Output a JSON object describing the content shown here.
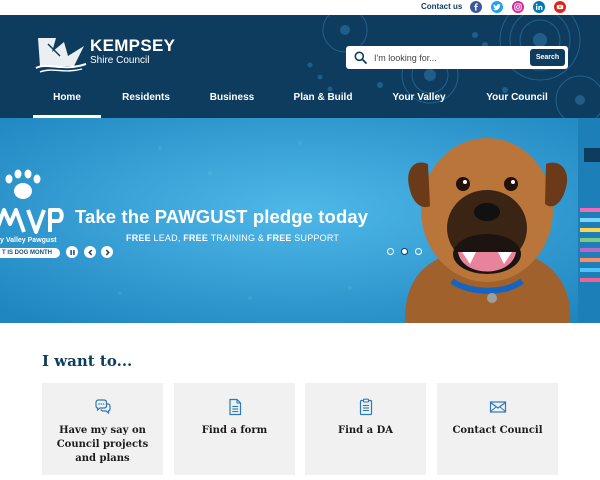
{
  "colors": {
    "brand_navy": "#0e3c5f",
    "banner_blue": "#2a9ad2",
    "card_grey": "#f1f1f1",
    "facebook": "#3b5998",
    "twitter": "#1da1f2",
    "instagram": "#d6249f",
    "linkedin": "#0077b5",
    "youtube": "#e62117"
  },
  "topbar": {
    "contact_label": "Contact us",
    "social": [
      {
        "name": "facebook",
        "icon": "facebook-icon"
      },
      {
        "name": "twitter",
        "icon": "twitter-icon"
      },
      {
        "name": "instagram",
        "icon": "instagram-icon"
      },
      {
        "name": "linkedin",
        "icon": "linkedin-icon"
      },
      {
        "name": "youtube",
        "icon": "youtube-icon"
      }
    ]
  },
  "header": {
    "logo_title": "KEMPSEY",
    "logo_subtitle": "Shire Council",
    "search": {
      "placeholder": "I'm looking for...",
      "button_label": "Search"
    },
    "nav": {
      "active": "Home",
      "items": [
        "Home",
        "Residents",
        "Business",
        "Plan & Build",
        "Your Valley",
        "Your Council"
      ]
    }
  },
  "hero": {
    "brand_fragment": "MVP",
    "brand_tagline": "y Valley Pawgust",
    "brand_pill": "T IS DOG MONTH",
    "headline": "Take the PAWGUST pledge today",
    "sub_free1": "FREE",
    "sub_lead": " LEAD, ",
    "sub_free2": "FREE",
    "sub_training": " TRAINING & ",
    "sub_free3": "FREE",
    "sub_support": " SUPPORT",
    "slides_total": 3,
    "active_slide": 2
  },
  "iwant": {
    "title": "I want to...",
    "cards": [
      {
        "label": "Have my say on Council projects and plans",
        "icon": "speech-bubbles-icon"
      },
      {
        "label": "Find a form",
        "icon": "document-icon"
      },
      {
        "label": "Find a DA",
        "icon": "clipboard-icon"
      },
      {
        "label": "Contact Council",
        "icon": "envelope-icon"
      }
    ]
  }
}
